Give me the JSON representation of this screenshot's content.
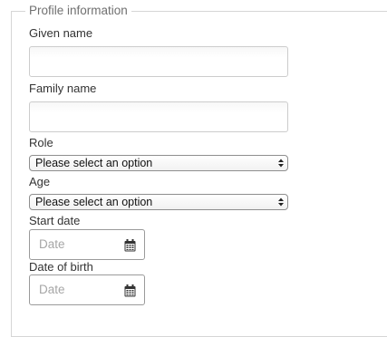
{
  "fieldset": {
    "legend": "Profile information"
  },
  "fields": {
    "given_name": {
      "label": "Given name",
      "value": ""
    },
    "family_name": {
      "label": "Family name",
      "value": ""
    },
    "role": {
      "label": "Role",
      "selected": "Please select an option"
    },
    "age": {
      "label": "Age",
      "selected": "Please select an option"
    },
    "start_date": {
      "label": "Start date",
      "placeholder": "Date",
      "icon": "calendar-icon"
    },
    "date_of_birth": {
      "label": "Date of birth",
      "placeholder": "Date",
      "icon": "calendar-icon"
    }
  }
}
